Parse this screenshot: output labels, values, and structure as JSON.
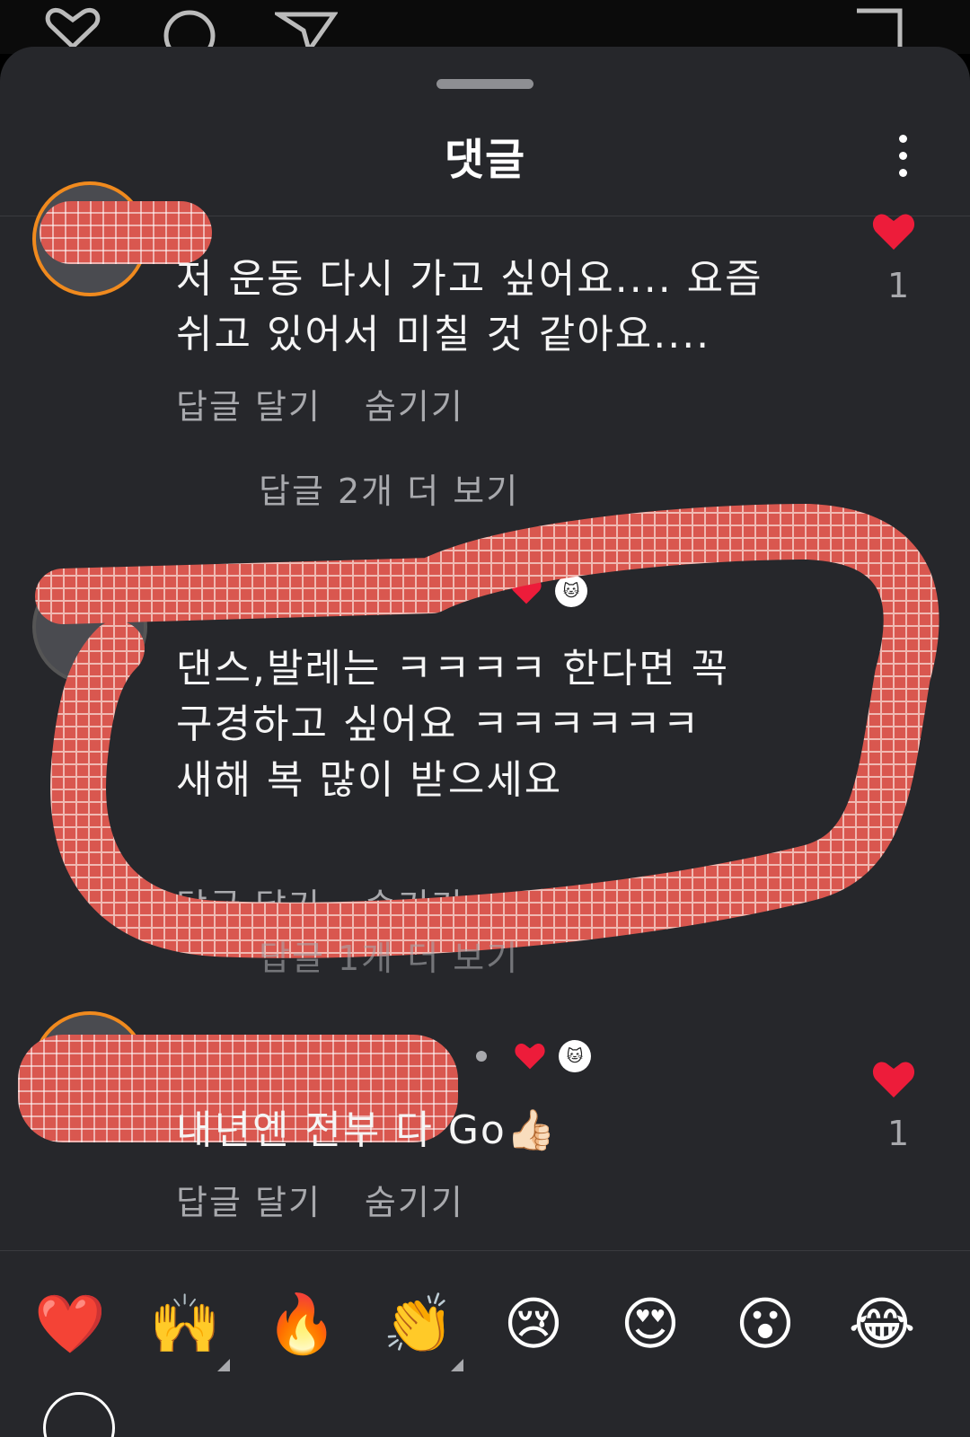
{
  "sheet": {
    "title": "댓글"
  },
  "comments": [
    {
      "text": "저 운동 다시 가고 싶어요.... 요즘\n쉬고 있어서 미칠 것 같아요....",
      "reply_label": "답글 달기",
      "hide_label": "숨기기",
      "like_count": "1"
    },
    {
      "more_replies": "답글 2개 더 보기",
      "text": "댄스,발레는 ㅋㅋㅋㅋ 한다면 꼭\n구경하고 싶어요 ㅋㅋㅋㅋㅋㅋ\n새해 복 많이 받으세요",
      "reply_label": "답글 달기",
      "hide_label": "숨기기"
    },
    {
      "more_replies": "답글 1개 더 보기",
      "text": "내년엔 전부 다 Go👍🏻",
      "reply_label": "답글 달기",
      "hide_label": "숨기기",
      "like_count": "1"
    }
  ],
  "emoji_bar": {
    "items": [
      "❤️",
      "🙌",
      "🔥",
      "👏",
      "😢",
      "😍",
      "😮",
      "😂"
    ]
  },
  "colors": {
    "sheet_bg": "#26272b",
    "heart": "#ed1c3a",
    "scribble": "#d9574f",
    "avatar_ring": "#f08a1e"
  }
}
